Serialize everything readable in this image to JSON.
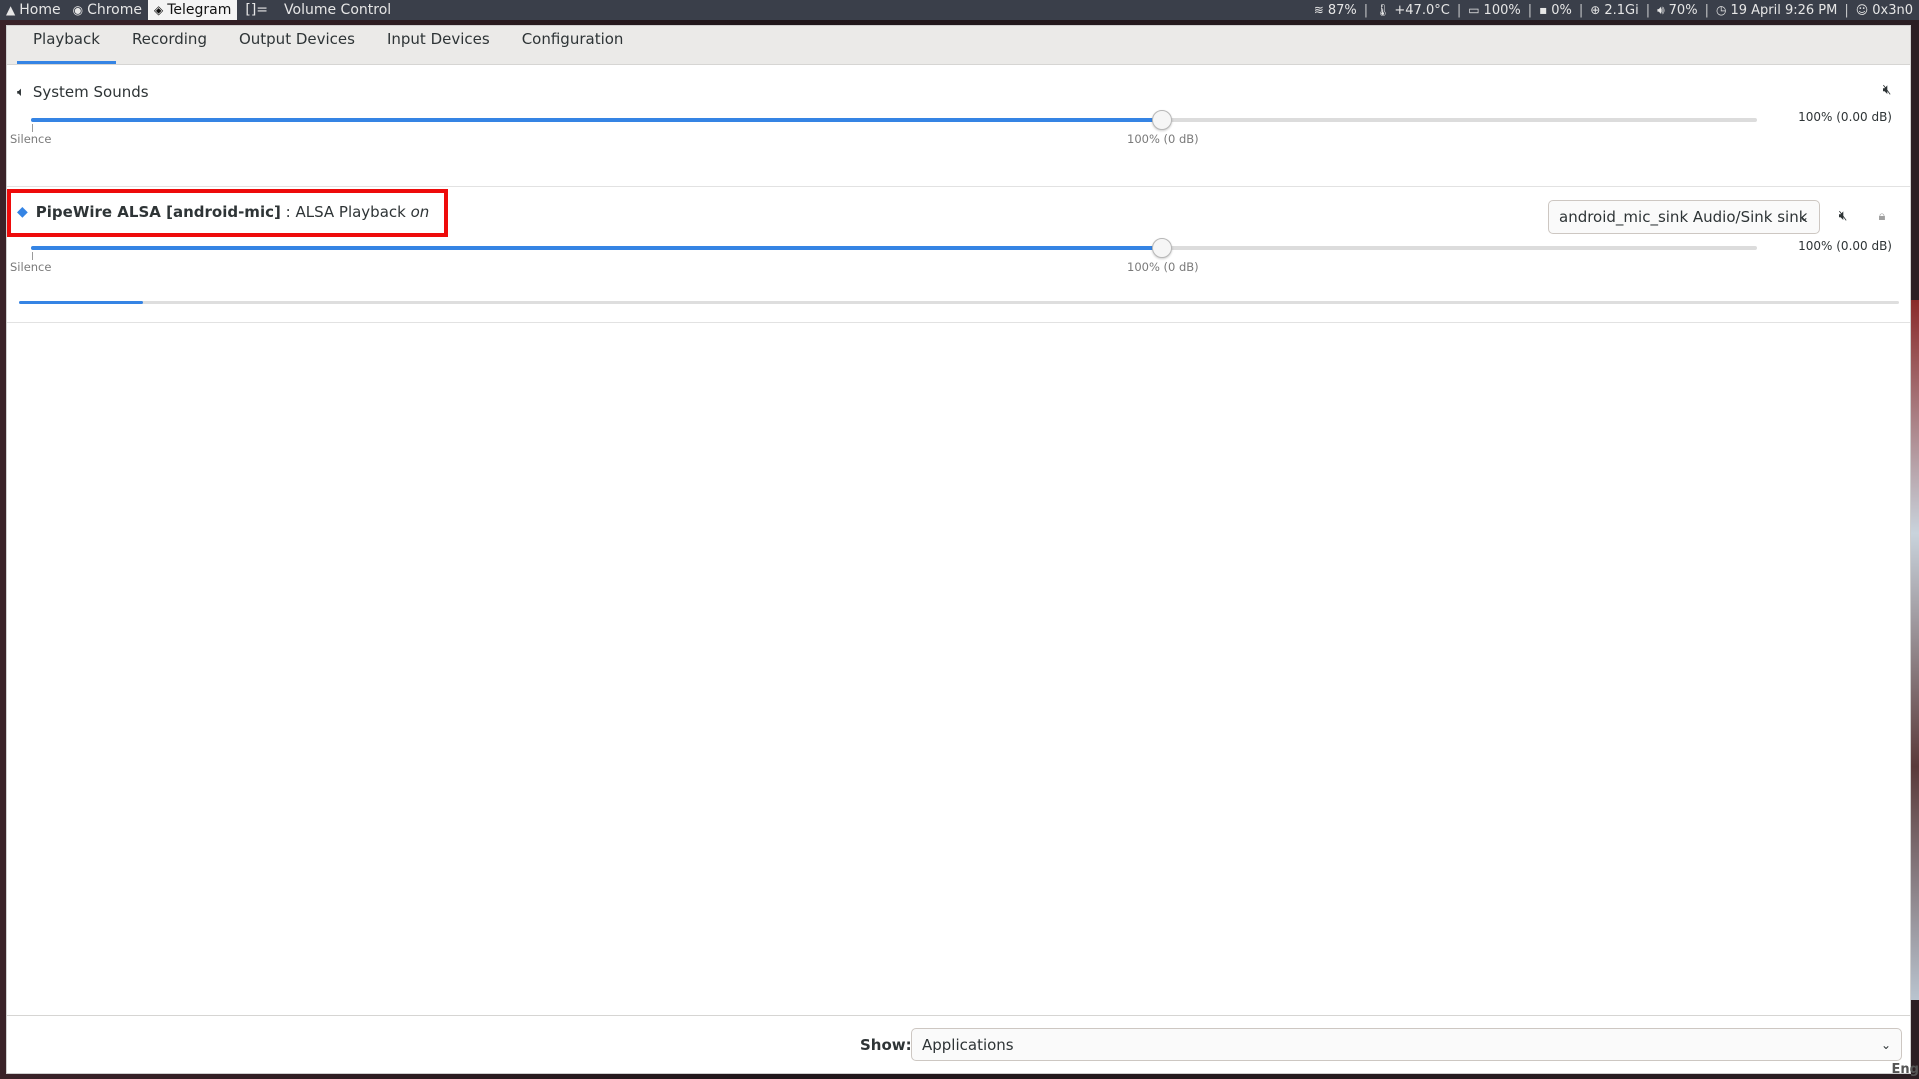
{
  "topbar": {
    "workspaces": [
      {
        "label": "Home",
        "icon": "arch-icon"
      },
      {
        "label": "Chrome",
        "icon": "chrome-icon"
      },
      {
        "label": "Telegram",
        "icon": "telegram-icon",
        "active": true
      }
    ],
    "layout_indicator": "[]=",
    "window_title": "Volume Control",
    "status": {
      "wifi": "87%",
      "temperature": "+47.0°C",
      "battery": "100%",
      "cpu": "0%",
      "memory": "2.1Gi",
      "volume": "70%",
      "datetime": "19 April 9:26 PM",
      "user": "0x3n0"
    }
  },
  "tabs": [
    "Playback",
    "Recording",
    "Output Devices",
    "Input Devices",
    "Configuration"
  ],
  "active_tab": "Playback",
  "streams": [
    {
      "name": "System Sounds",
      "icon": "speaker-icon",
      "volume_readout": "100% (0.00 dB)",
      "volume_fraction": 0.655,
      "mark_min": "Silence",
      "mark_norm": "100% (0 dB)"
    },
    {
      "app_name": "PipeWire ALSA [android-mic]",
      "separator": ":",
      "stream_name": "ALSA Playback",
      "state": "on",
      "icon": "pipewire-icon",
      "sink": "android_mic_sink Audio/Sink sink",
      "volume_readout": "100% (0.00 dB)",
      "volume_fraction": 0.655,
      "peak_fraction": 0.066,
      "mark_min": "Silence",
      "mark_norm": "100% (0 dB)"
    }
  ],
  "footer": {
    "show_label": "Show:",
    "show_value": "Applications"
  },
  "corner_text": "Eng",
  "colors": {
    "accent": "#3584e4",
    "highlight": "#ee0b0b",
    "topbar_bg": "#3a3f4a"
  }
}
